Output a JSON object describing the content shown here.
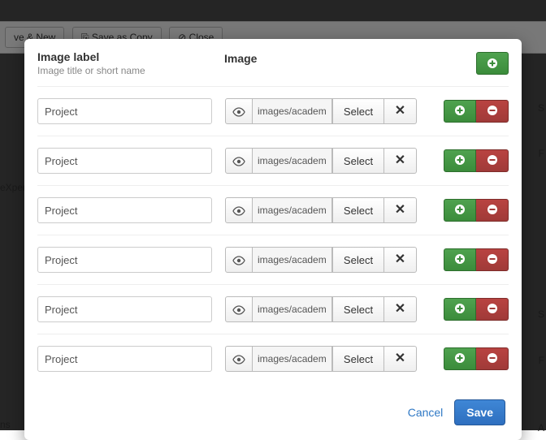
{
  "background": {
    "btn_new": "ve & New",
    "btn_copy": "Save as Copy",
    "btn_close": "Close",
    "left_label1": "eXpert",
    "left_label2": "ns",
    "right_s": "S",
    "right_f": "F",
    "right_s2": "S",
    "right_f2": "F",
    "right_a": "A"
  },
  "header": {
    "label_title": "Image label",
    "label_sub": "Image title or short name",
    "image_title": "Image"
  },
  "buttons": {
    "select": "Select",
    "cancel": "Cancel",
    "save": "Save"
  },
  "rows": [
    {
      "label": "Project",
      "path": "images/academ"
    },
    {
      "label": "Project",
      "path": "images/academ"
    },
    {
      "label": "Project",
      "path": "images/academ"
    },
    {
      "label": "Project",
      "path": "images/academ"
    },
    {
      "label": "Project",
      "path": "images/academ"
    },
    {
      "label": "Project",
      "path": "images/academ"
    }
  ],
  "colors": {
    "primary": "#2e6fbf",
    "success": "#3b8c3b",
    "danger": "#a03a38"
  }
}
